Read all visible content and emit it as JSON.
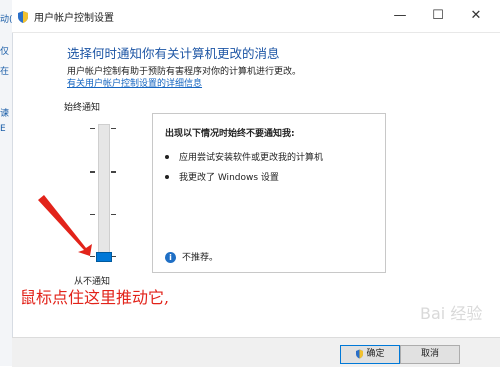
{
  "window": {
    "title": "用户帐户控制设置",
    "min_glyph": "—",
    "max_glyph": "☐",
    "close_glyph": "✕"
  },
  "background_window": {
    "fragments": [
      "动(",
      "仅",
      "在",
      "谏",
      "E"
    ]
  },
  "content": {
    "heading": "选择何时通知你有关计算机更改的消息",
    "description": "用户帐户控制有助于预防有害程序对你的计算机进行更改。",
    "link": "有关用户帐户控制设置的详细信息"
  },
  "slider": {
    "top_label": "始终通知",
    "bottom_label": "从不通知",
    "levels": 4,
    "current_level": 1
  },
  "panel": {
    "heading": "出现以下情况时始终不要通知我:",
    "items": [
      "应用尝试安装软件或更改我的计算机",
      "我更改了 Windows 设置"
    ],
    "recommendation": "不推荐。",
    "info_icon": "info-icon"
  },
  "annotation": {
    "text": "鼠标点住这里推动它,",
    "color": "#e2231a"
  },
  "buttons": {
    "ok": "确定",
    "cancel": "取消"
  },
  "watermark": "Bai 经验",
  "colors": {
    "accent": "#0078d7",
    "heading": "#1e56a5",
    "link": "#1565c0",
    "annotation": "#e2231a"
  }
}
